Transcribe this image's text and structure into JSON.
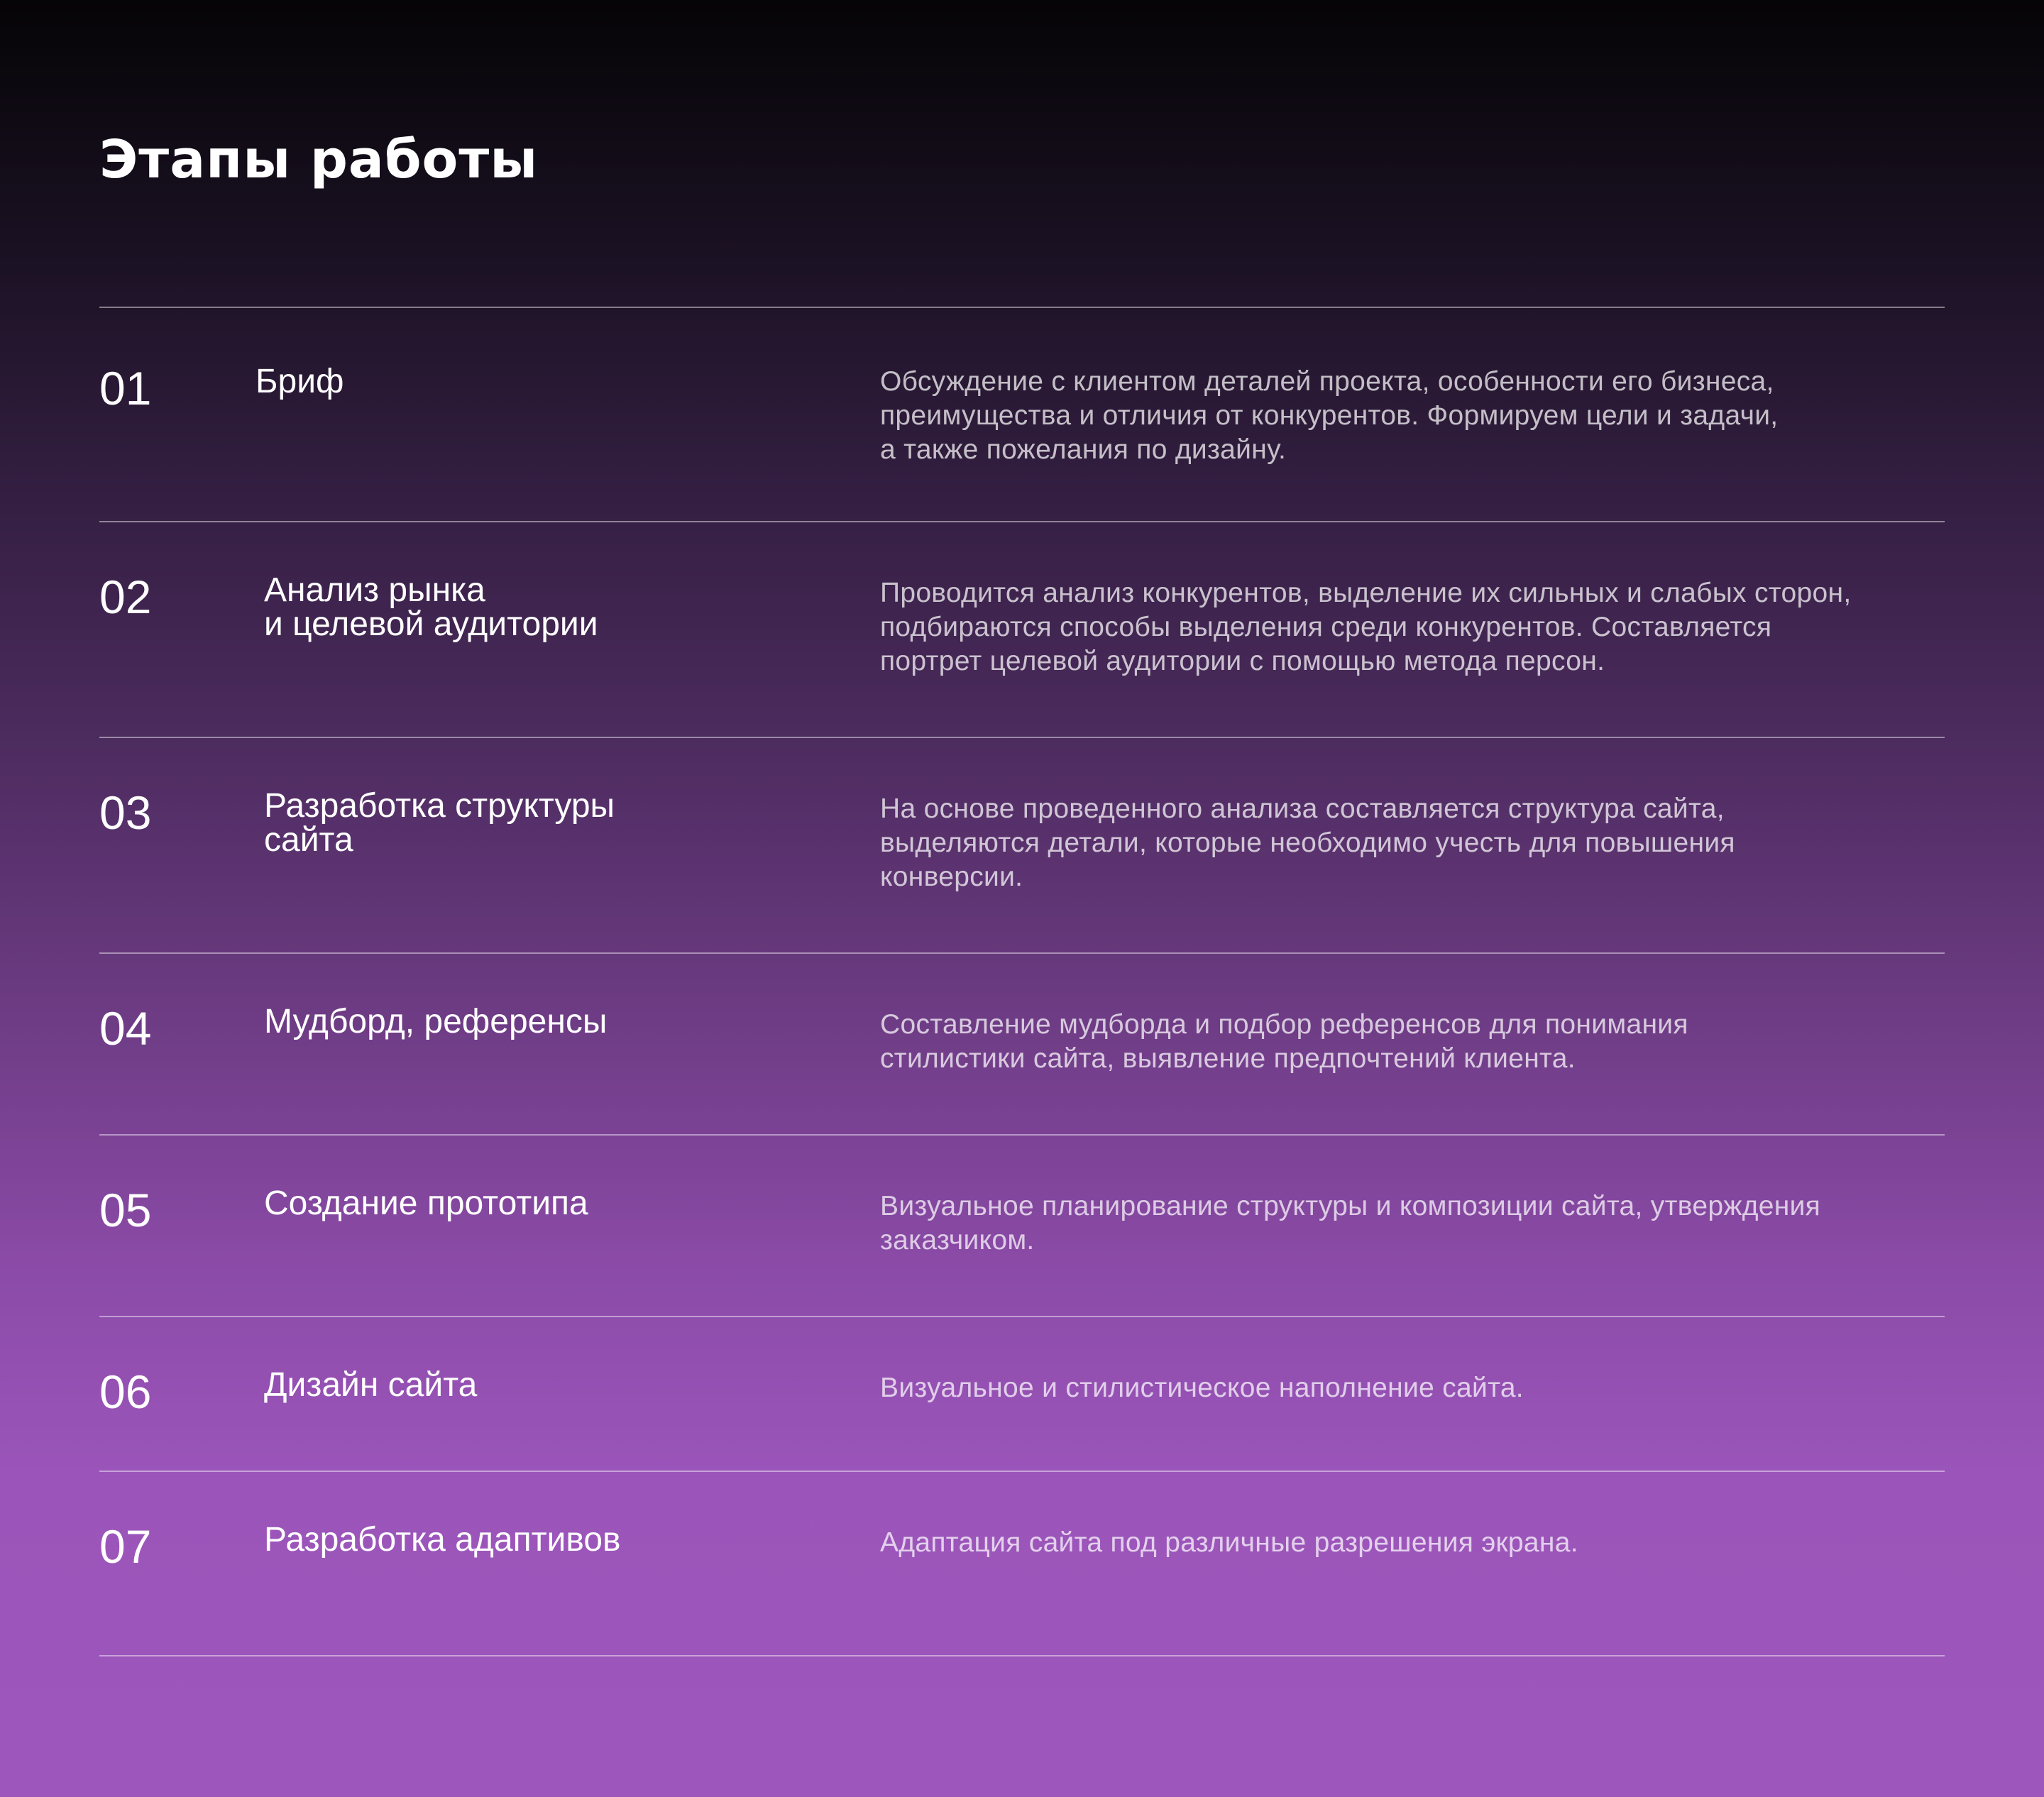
{
  "page": {
    "title": "Этапы работы"
  },
  "stages": [
    {
      "number": "01",
      "name": "Бриф",
      "description": "Обсуждение с клиентом деталей проекта, особенности его бизнеса,\nпреимущества и отличия от конкурентов. Формируем цели и задачи,\nа также пожелания по дизайну."
    },
    {
      "number": "02",
      "name": "Анализ рынка\nи целевой аудитории",
      "description": "Проводится анализ конкурентов, выделение их сильных и слабых сторон,\nподбираются способы выделения среди конкурентов. Составляется\nпортрет целевой аудитории с помощью метода персон."
    },
    {
      "number": "03",
      "name": "Разработка структуры\nсайта",
      "description": "На основе проведенного анализа составляется структура сайта,\nвыделяются детали, которые необходимо учесть для повышения\nконверсии."
    },
    {
      "number": "04",
      "name": "Мудборд, референсы",
      "description": "Составление мудборда и подбор референсов для понимания\nстилистики сайта, выявление предпочтений клиента."
    },
    {
      "number": "05",
      "name": "Создание прототипа",
      "description": "Визуальное планирование структуры и композиции сайта, утверждения\nзаказчиком."
    },
    {
      "number": "06",
      "name": "Дизайн сайта",
      "description": "Визуальное и стилистическое наполнение сайта."
    },
    {
      "number": "07",
      "name": "Разработка адаптивов",
      "description": "Адаптация сайта под различные разрешения экрана."
    }
  ],
  "colors": {
    "background_top": "#050406",
    "background_bottom": "#9d57bc",
    "text_primary": "#ffffff",
    "divider": "#b89ac6"
  }
}
